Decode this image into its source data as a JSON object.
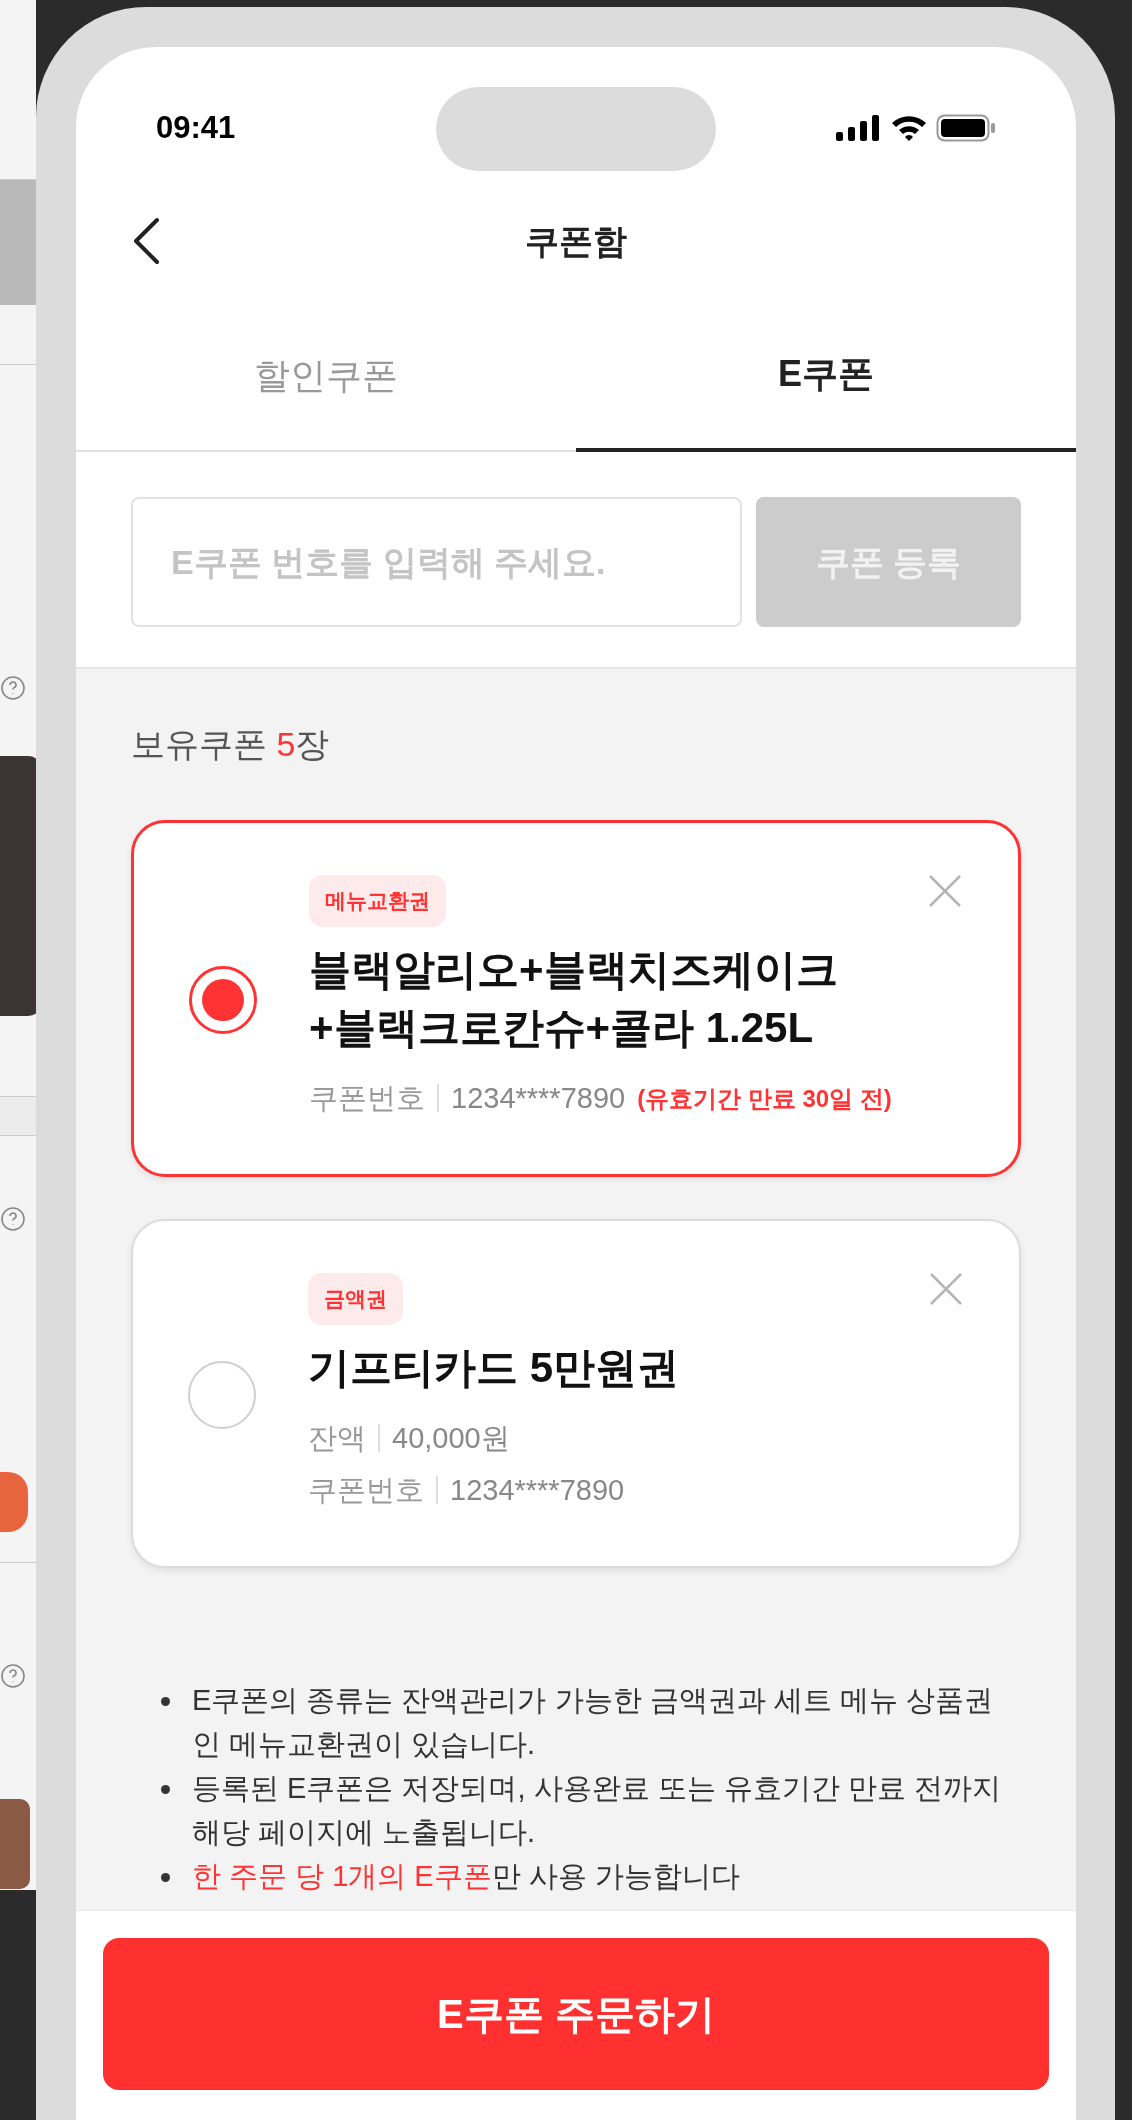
{
  "status_bar": {
    "time": "09:41"
  },
  "header": {
    "title": "쿠폰함"
  },
  "tabs": [
    {
      "label": "할인쿠폰",
      "selected": false
    },
    {
      "label": "E쿠폰",
      "selected": true
    }
  ],
  "register": {
    "placeholder": "E쿠폰 번호를 입력해 주세요.",
    "button": "쿠폰 등록",
    "disabled": true
  },
  "owned": {
    "label": "보유쿠폰",
    "count": "5",
    "unit": "장"
  },
  "coupons": [
    {
      "tag": "메뉴교환권",
      "name": "블랙알리오+블랙치즈케이크\n+블랙크로칸슈+콜라 1.25L",
      "selected": true,
      "details": [
        {
          "label": "쿠폰번호",
          "value": "1234****7890",
          "note": "(유효기간 만료 30일 전)"
        }
      ]
    },
    {
      "tag": "금액권",
      "name": "기프티카드 5만원권",
      "selected": false,
      "details": [
        {
          "label": "잔액",
          "value": "40,000원"
        },
        {
          "label": "쿠폰번호",
          "value": "1234****7890"
        }
      ]
    }
  ],
  "notes": [
    {
      "text": "E쿠폰의 종류는 잔액관리가 가능한 금액권과 세트 메뉴 상품권인 메뉴교환권이 있습니다."
    },
    {
      "text": "등록된 E쿠폰은 저장되며, 사용완료 또는 유효기간 만료 전까지 해당 페이지에 노출됩니다."
    },
    {
      "highlight": "한 주문 당 1개의 E쿠폰",
      "text": "만 사용 가능합니다"
    }
  ],
  "order_button": "E쿠폰 주문하기"
}
